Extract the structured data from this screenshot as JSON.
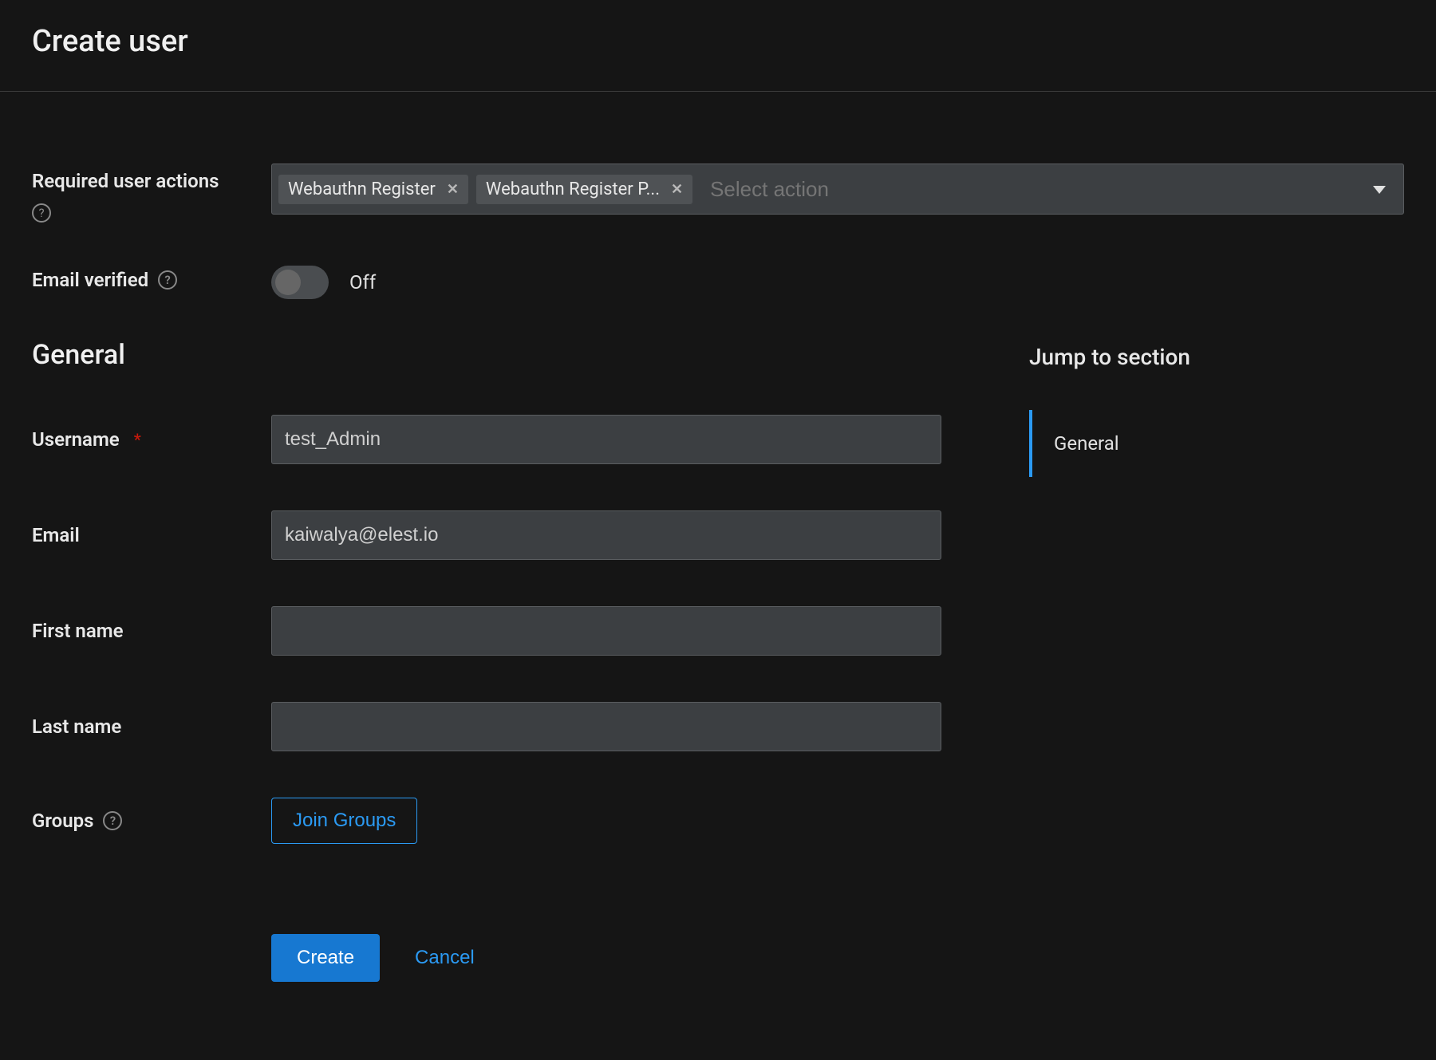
{
  "page": {
    "title": "Create user"
  },
  "required_actions": {
    "label": "Required user actions",
    "chips": [
      {
        "label": "Webauthn Register"
      },
      {
        "label": "Webauthn Register P..."
      }
    ],
    "placeholder": "Select action"
  },
  "email_verified": {
    "label": "Email verified",
    "state_label": "Off"
  },
  "general": {
    "section_title": "General",
    "username": {
      "label": "Username",
      "value": "test_Admin"
    },
    "email": {
      "label": "Email",
      "value": "kaiwalya@elest.io"
    },
    "first_name": {
      "label": "First name",
      "value": ""
    },
    "last_name": {
      "label": "Last name",
      "value": ""
    },
    "groups": {
      "label": "Groups",
      "button": "Join Groups"
    }
  },
  "actions": {
    "create": "Create",
    "cancel": "Cancel"
  },
  "jump": {
    "title": "Jump to section",
    "items": [
      {
        "label": "General"
      }
    ]
  }
}
